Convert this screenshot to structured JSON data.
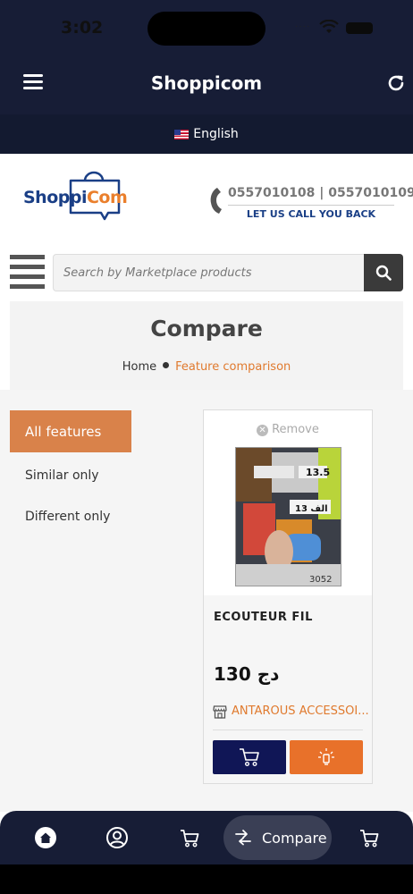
{
  "status_bar": {
    "time": "3:02"
  },
  "app_bar": {
    "title": "Shoppicom"
  },
  "language": {
    "label": "English"
  },
  "header": {
    "logo_part1": "Shoppi",
    "logo_part2": "Com",
    "phone_numbers": "0557010108 | 0557010109",
    "call_back": "LET US CALL YOU BACK"
  },
  "search": {
    "placeholder": "Search by Marketplace products"
  },
  "page": {
    "title": "Compare",
    "breadcrumb_home": "Home",
    "breadcrumb_current": "Feature comparison"
  },
  "filters": [
    {
      "label": "All features",
      "active": true
    },
    {
      "label": "Similar only",
      "active": false
    },
    {
      "label": "Different only",
      "active": false
    }
  ],
  "product": {
    "remove_label": "Remove",
    "name": "ECOUTEUR FIL",
    "price": "130 دج",
    "shop": "ANTAROUS ACCESSOI...",
    "image_labels": [
      "13.5",
      "13 الف",
      "3052"
    ]
  },
  "bottom_nav": {
    "items": [
      "home-icon",
      "account-icon",
      "cart-icon",
      "compare-icon",
      "cart-icon"
    ],
    "compare_label": "Compare"
  },
  "colors": {
    "navy": "#171d36",
    "accent_orange": "#e07a2e",
    "filter_active": "#d9824a",
    "cart_button": "#101656"
  }
}
